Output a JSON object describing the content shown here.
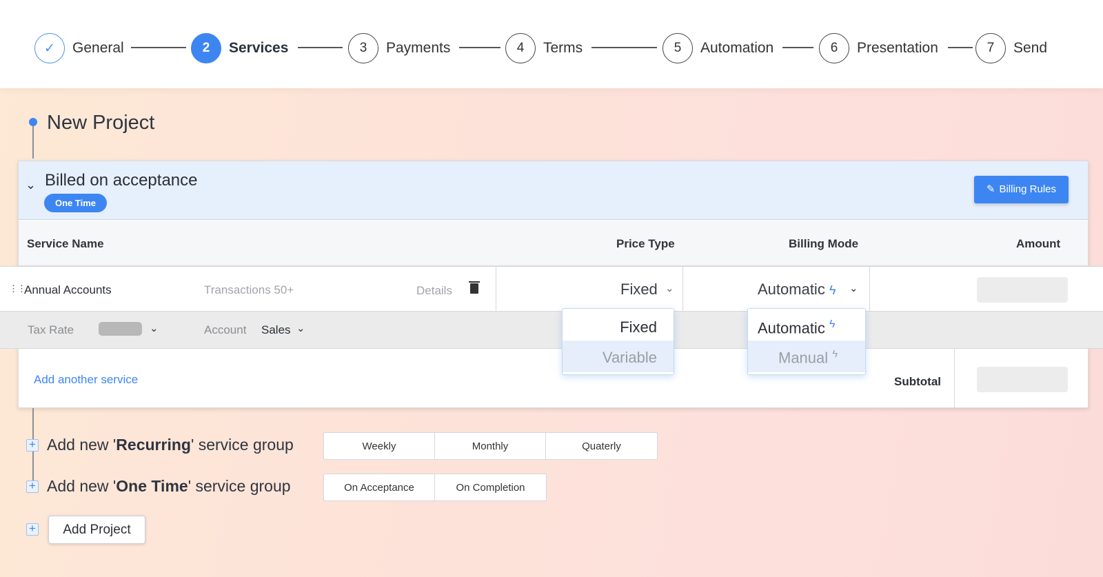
{
  "stepper": {
    "steps": [
      {
        "num": "✓",
        "label": "General"
      },
      {
        "num": "2",
        "label": "Services"
      },
      {
        "num": "3",
        "label": "Payments"
      },
      {
        "num": "4",
        "label": "Terms"
      },
      {
        "num": "5",
        "label": "Automation"
      },
      {
        "num": "6",
        "label": "Presentation"
      },
      {
        "num": "7",
        "label": "Send"
      }
    ]
  },
  "project": {
    "title": "New Project"
  },
  "group": {
    "title": "Billed on acceptance",
    "badge": "One Time",
    "billing_rules_label": "Billing Rules"
  },
  "table": {
    "headers": {
      "service_name": "Service Name",
      "price_type": "Price Type",
      "billing_mode": "Billing Mode",
      "amount": "Amount"
    },
    "row": {
      "service_name": "Annual Accounts",
      "description": "Transactions 50+",
      "details_label": "Details",
      "price_type": "Fixed",
      "billing_mode": "Automatic"
    },
    "subrow": {
      "tax_label": "Tax Rate",
      "account_label": "Account",
      "account_value": "Sales"
    },
    "add_service_label": "Add another service",
    "subtotal_label": "Subtotal"
  },
  "price_dropdown": {
    "options": [
      "Fixed",
      "Variable"
    ],
    "selected": "Fixed"
  },
  "mode_dropdown": {
    "options": [
      "Automatic",
      "Manual"
    ],
    "selected": "Automatic"
  },
  "groups_add": {
    "recurring": {
      "prefix": "Add new '",
      "name": "Recurring",
      "suffix": "' service group",
      "options": [
        "Weekly",
        "Monthly",
        "Quaterly"
      ]
    },
    "one_time": {
      "prefix": "Add new '",
      "name": "One Time",
      "suffix": "' service group",
      "options": [
        "On Acceptance",
        "On Completion"
      ]
    }
  },
  "add_project_label": "Add Project",
  "icons": {
    "bolt": "bolt-icon",
    "pencil": "pencil-icon",
    "trash": "trash-icon",
    "plus": "plus-icon"
  },
  "colors": {
    "accent": "#3d86f2",
    "header_bg": "#e6effc"
  }
}
